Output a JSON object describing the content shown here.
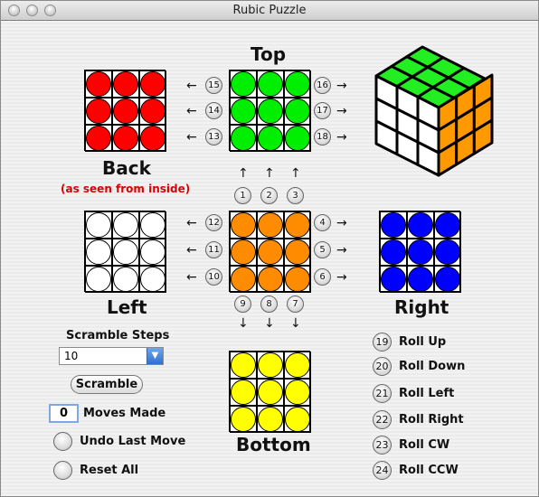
{
  "window": {
    "title": "Rubic Puzzle"
  },
  "faces": {
    "top": {
      "label": "Top",
      "color": "#00ee00"
    },
    "back": {
      "label": "Back",
      "note": "(as seen from inside)",
      "color": "#ff0000"
    },
    "left": {
      "label": "Left",
      "color": "#ffffff"
    },
    "front": {
      "color": "#ff8c00"
    },
    "right": {
      "label": "Right",
      "color": "#0000ff"
    },
    "bottom": {
      "label": "Bottom",
      "color": "#ffff00"
    }
  },
  "moves": [
    "1",
    "2",
    "3",
    "4",
    "5",
    "6",
    "7",
    "8",
    "9",
    "10",
    "11",
    "12",
    "13",
    "14",
    "15",
    "16",
    "17",
    "18"
  ],
  "scramble": {
    "label": "Scramble Steps",
    "value": "10",
    "button": "Scramble"
  },
  "moves_made": {
    "value": "0",
    "label": "Moves Made"
  },
  "undo_label": "Undo Last Move",
  "reset_label": "Reset All",
  "actions": [
    {
      "num": "19",
      "label": "Roll Up"
    },
    {
      "num": "20",
      "label": "Roll Down"
    },
    {
      "num": "21",
      "label": "Roll Left"
    },
    {
      "num": "22",
      "label": "Roll Right"
    },
    {
      "num": "23",
      "label": "Roll CW"
    },
    {
      "num": "24",
      "label": "Roll CCW"
    }
  ],
  "cube_colors": {
    "top": "#22ee22",
    "left": "#ffffff",
    "right": "#ff9900"
  }
}
